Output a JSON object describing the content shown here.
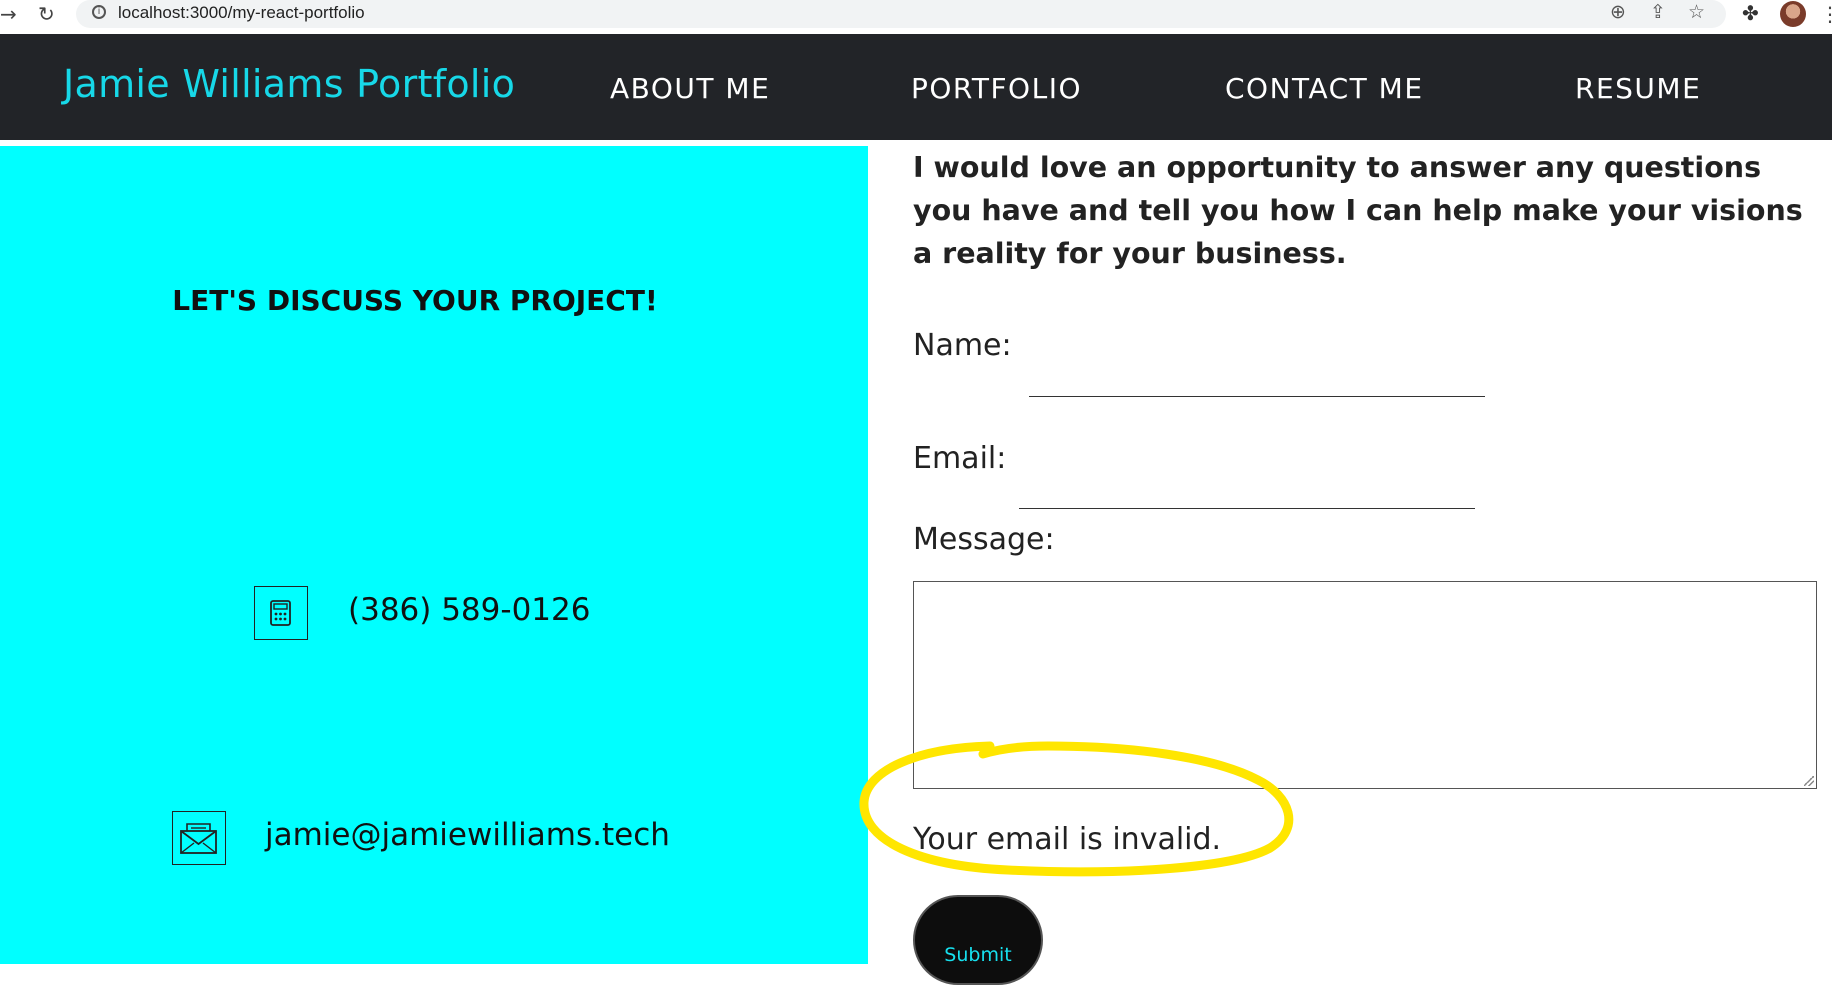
{
  "browser": {
    "url": "localhost:3000/my-react-portfolio",
    "icons": [
      "back-arrow-icon",
      "reload-icon",
      "site-info-icon",
      "zoom-icon",
      "share-icon",
      "bookmark-star-icon",
      "extensions-puzzle-icon",
      "profile-avatar",
      "more-icon"
    ]
  },
  "header": {
    "brand": "Jamie Williams Portfolio",
    "nav": [
      "ABOUT ME",
      "PORTFOLIO",
      "CONTACT ME",
      "RESUME"
    ],
    "brand_color": "#17d8e8",
    "background": "#222428"
  },
  "contact_panel": {
    "heading": "LET'S DISCUSS YOUR PROJECT!",
    "phone": "(386) 589-0126",
    "email": "jamie@jamiewilliams.tech",
    "background": "#00ffff"
  },
  "form": {
    "intro": "I would love an opportunity to answer any questions you have and tell you how I can help make your visions a reality for your business.",
    "name_label": "Name:",
    "email_label": "Email:",
    "message_label": "Message:",
    "name_value": "",
    "email_value": "",
    "message_value": "",
    "error": "Your email is invalid.",
    "submit": "Submit",
    "highlight_color": "#ffe600"
  }
}
